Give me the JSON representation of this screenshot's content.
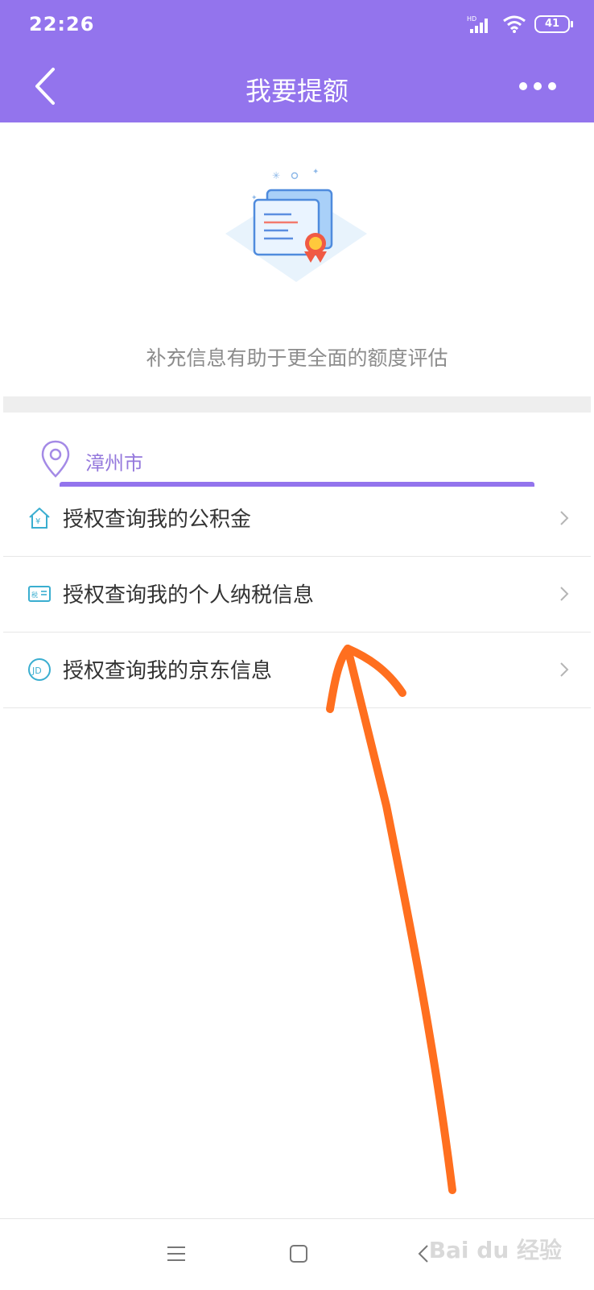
{
  "status": {
    "time": "22:26",
    "network": "HD",
    "battery": "41"
  },
  "header": {
    "title": "我要提额"
  },
  "hero": {
    "subtitle": "补充信息有助于更全面的额度评估"
  },
  "location": {
    "city": "漳州市"
  },
  "list": {
    "items": [
      {
        "label": "授权查询我的公积金",
        "icon": "house-yuan-icon"
      },
      {
        "label": "授权查询我的个人纳税信息",
        "icon": "tax-card-icon",
        "icon_text": "税"
      },
      {
        "label": "授权查询我的京东信息",
        "icon": "jd-icon",
        "icon_text": "JD"
      }
    ]
  },
  "watermark": {
    "text": "Bai du 经验"
  },
  "colors": {
    "accent": "#9374ed",
    "icon_teal": "#3aaed0",
    "annotation_arrow": "#ff6f1f"
  }
}
